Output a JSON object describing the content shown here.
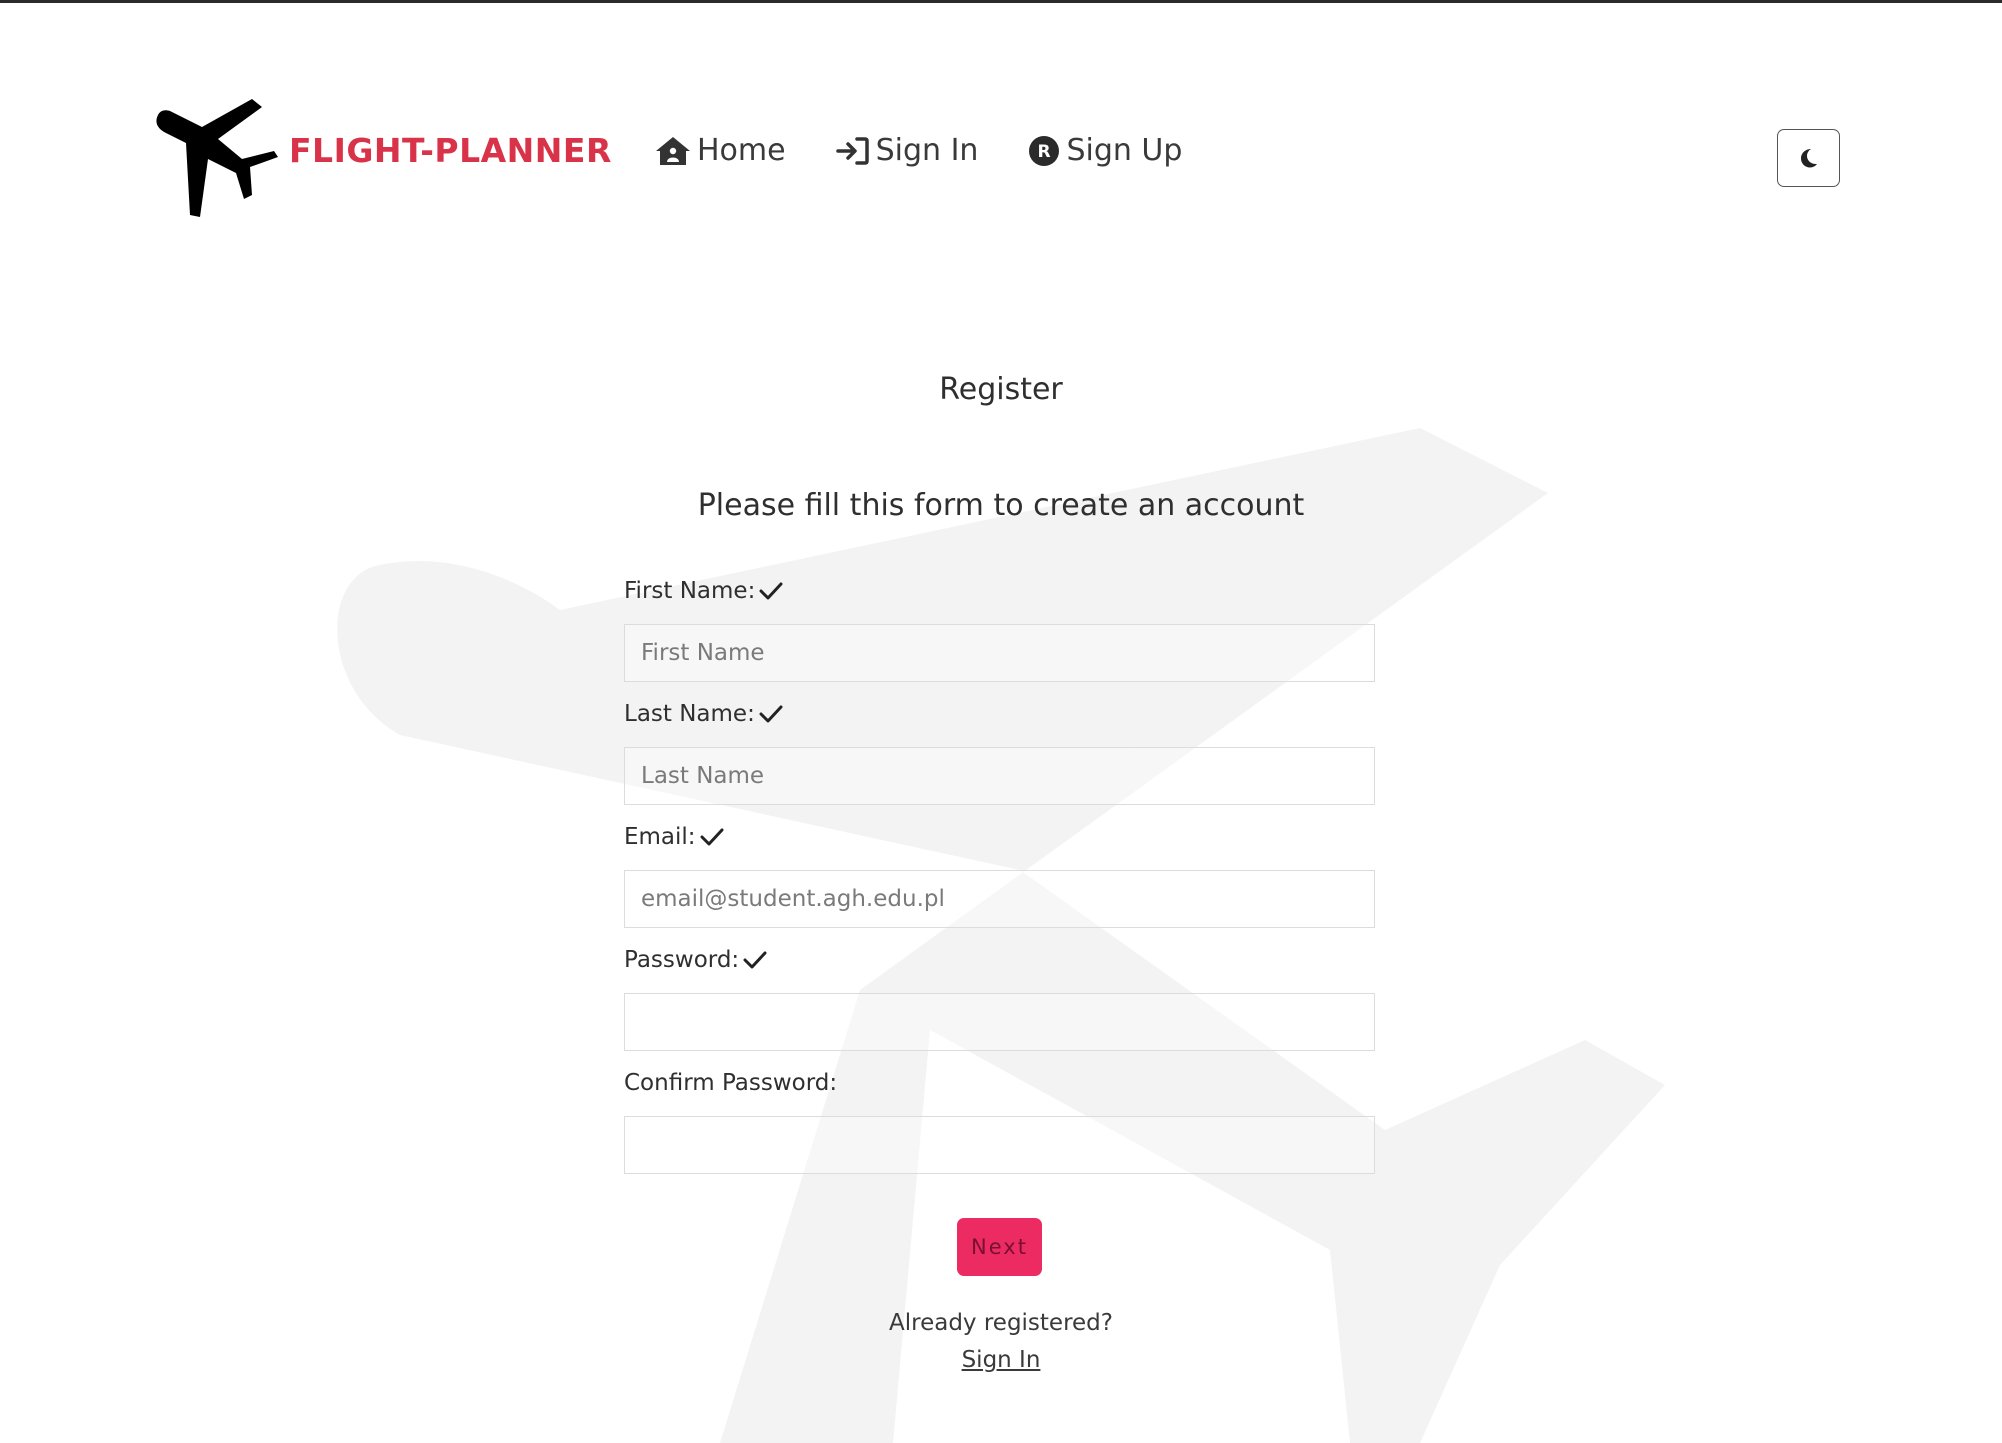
{
  "brand": {
    "name": "FLIGHT-PLANNER",
    "accent_color": "#d9334a",
    "logo_icon": "airplane-icon"
  },
  "nav": {
    "items": [
      {
        "label": "Home",
        "icon": "home-icon"
      },
      {
        "label": "Sign In",
        "icon": "sign-in-icon"
      },
      {
        "label": "Sign Up",
        "icon": "registered-icon"
      }
    ],
    "theme_toggle_icon": "moon-icon"
  },
  "form": {
    "title": "Register",
    "subtitle": "Please fill this form to create an account",
    "fields": [
      {
        "label": "First Name:",
        "placeholder": "First Name",
        "value": "",
        "validated": true
      },
      {
        "label": "Last Name:",
        "placeholder": "Last Name",
        "value": "",
        "validated": true
      },
      {
        "label": "Email:",
        "placeholder": "email@student.agh.edu.pl",
        "value": "",
        "validated": true
      },
      {
        "label": "Password:",
        "placeholder": "",
        "value": "",
        "validated": true
      },
      {
        "label": "Confirm Password:",
        "placeholder": "",
        "value": "",
        "validated": false
      }
    ],
    "next_label": "Next",
    "next_color": "#ec2b63",
    "already_registered": "Already registered?",
    "sign_in_link": "Sign In"
  }
}
